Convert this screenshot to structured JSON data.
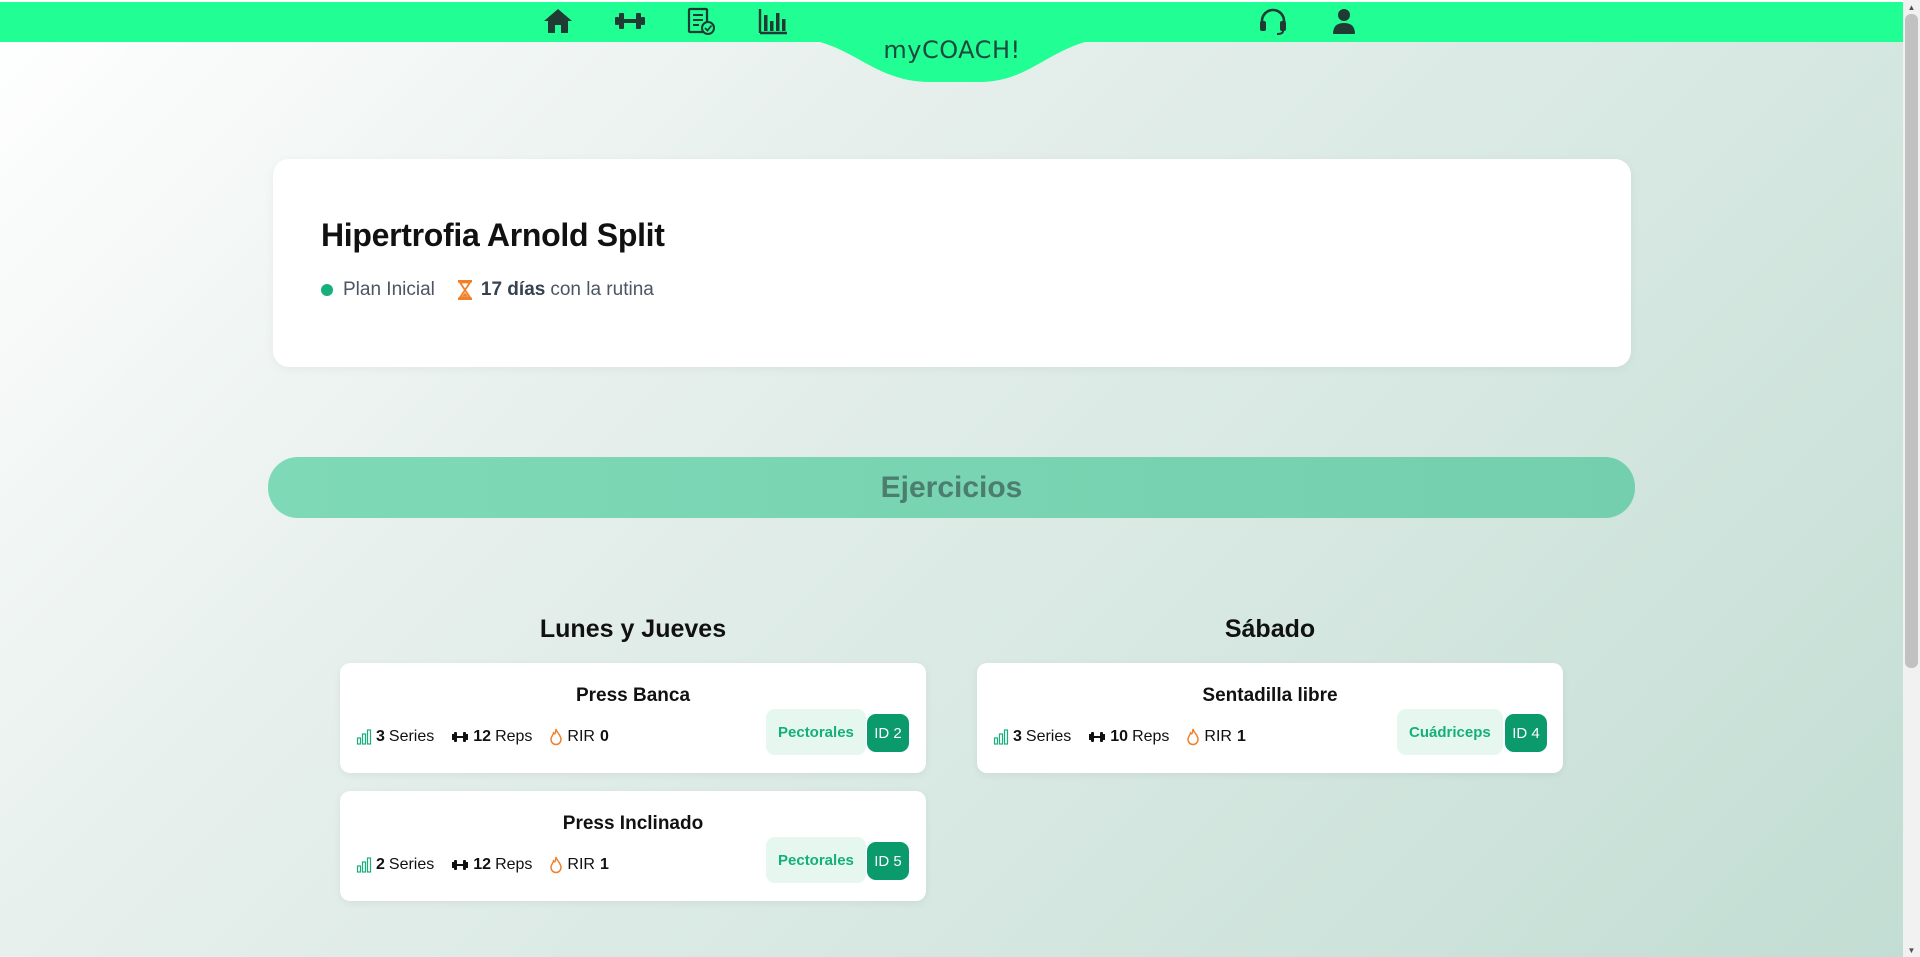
{
  "nav": {
    "brand": "myCOACH!",
    "icons": [
      "home-icon",
      "dumbbell-icon",
      "routine-checklist-icon",
      "stats-chart-icon",
      "headset-icon",
      "user-icon"
    ]
  },
  "plan": {
    "title": "Hipertrofia Arnold Split",
    "status": "Plan Inicial",
    "days_value": "17 días",
    "days_suffix": "con la rutina"
  },
  "section": {
    "title": "Ejercicios"
  },
  "days": [
    {
      "title": "Lunes y Jueves",
      "exercises": [
        {
          "name": "Press Banca",
          "series_value": "3",
          "series_label": "Series",
          "reps_value": "12",
          "reps_label": "Reps",
          "rir_label": "RIR",
          "rir_value": "0",
          "muscle": "Pectorales",
          "id": "ID 2"
        },
        {
          "name": "Press Inclinado",
          "series_value": "2",
          "series_label": "Series",
          "reps_value": "12",
          "reps_label": "Reps",
          "rir_label": "RIR",
          "rir_value": "1",
          "muscle": "Pectorales",
          "id": "ID 5"
        }
      ]
    },
    {
      "title": "Sábado",
      "exercises": [
        {
          "name": "Sentadilla libre",
          "series_value": "3",
          "series_label": "Series",
          "reps_value": "10",
          "reps_label": "Reps",
          "rir_label": "RIR",
          "rir_value": "1",
          "muscle": "Cuádriceps",
          "id": "ID 4"
        }
      ]
    }
  ],
  "colors": {
    "nav_green": "#21fe93",
    "brand_text": "#1c4a3e",
    "accent": "#17b07a",
    "id_badge": "#0a9a6c",
    "section_band": "#7ed9b6",
    "fire": "#f0802a"
  }
}
